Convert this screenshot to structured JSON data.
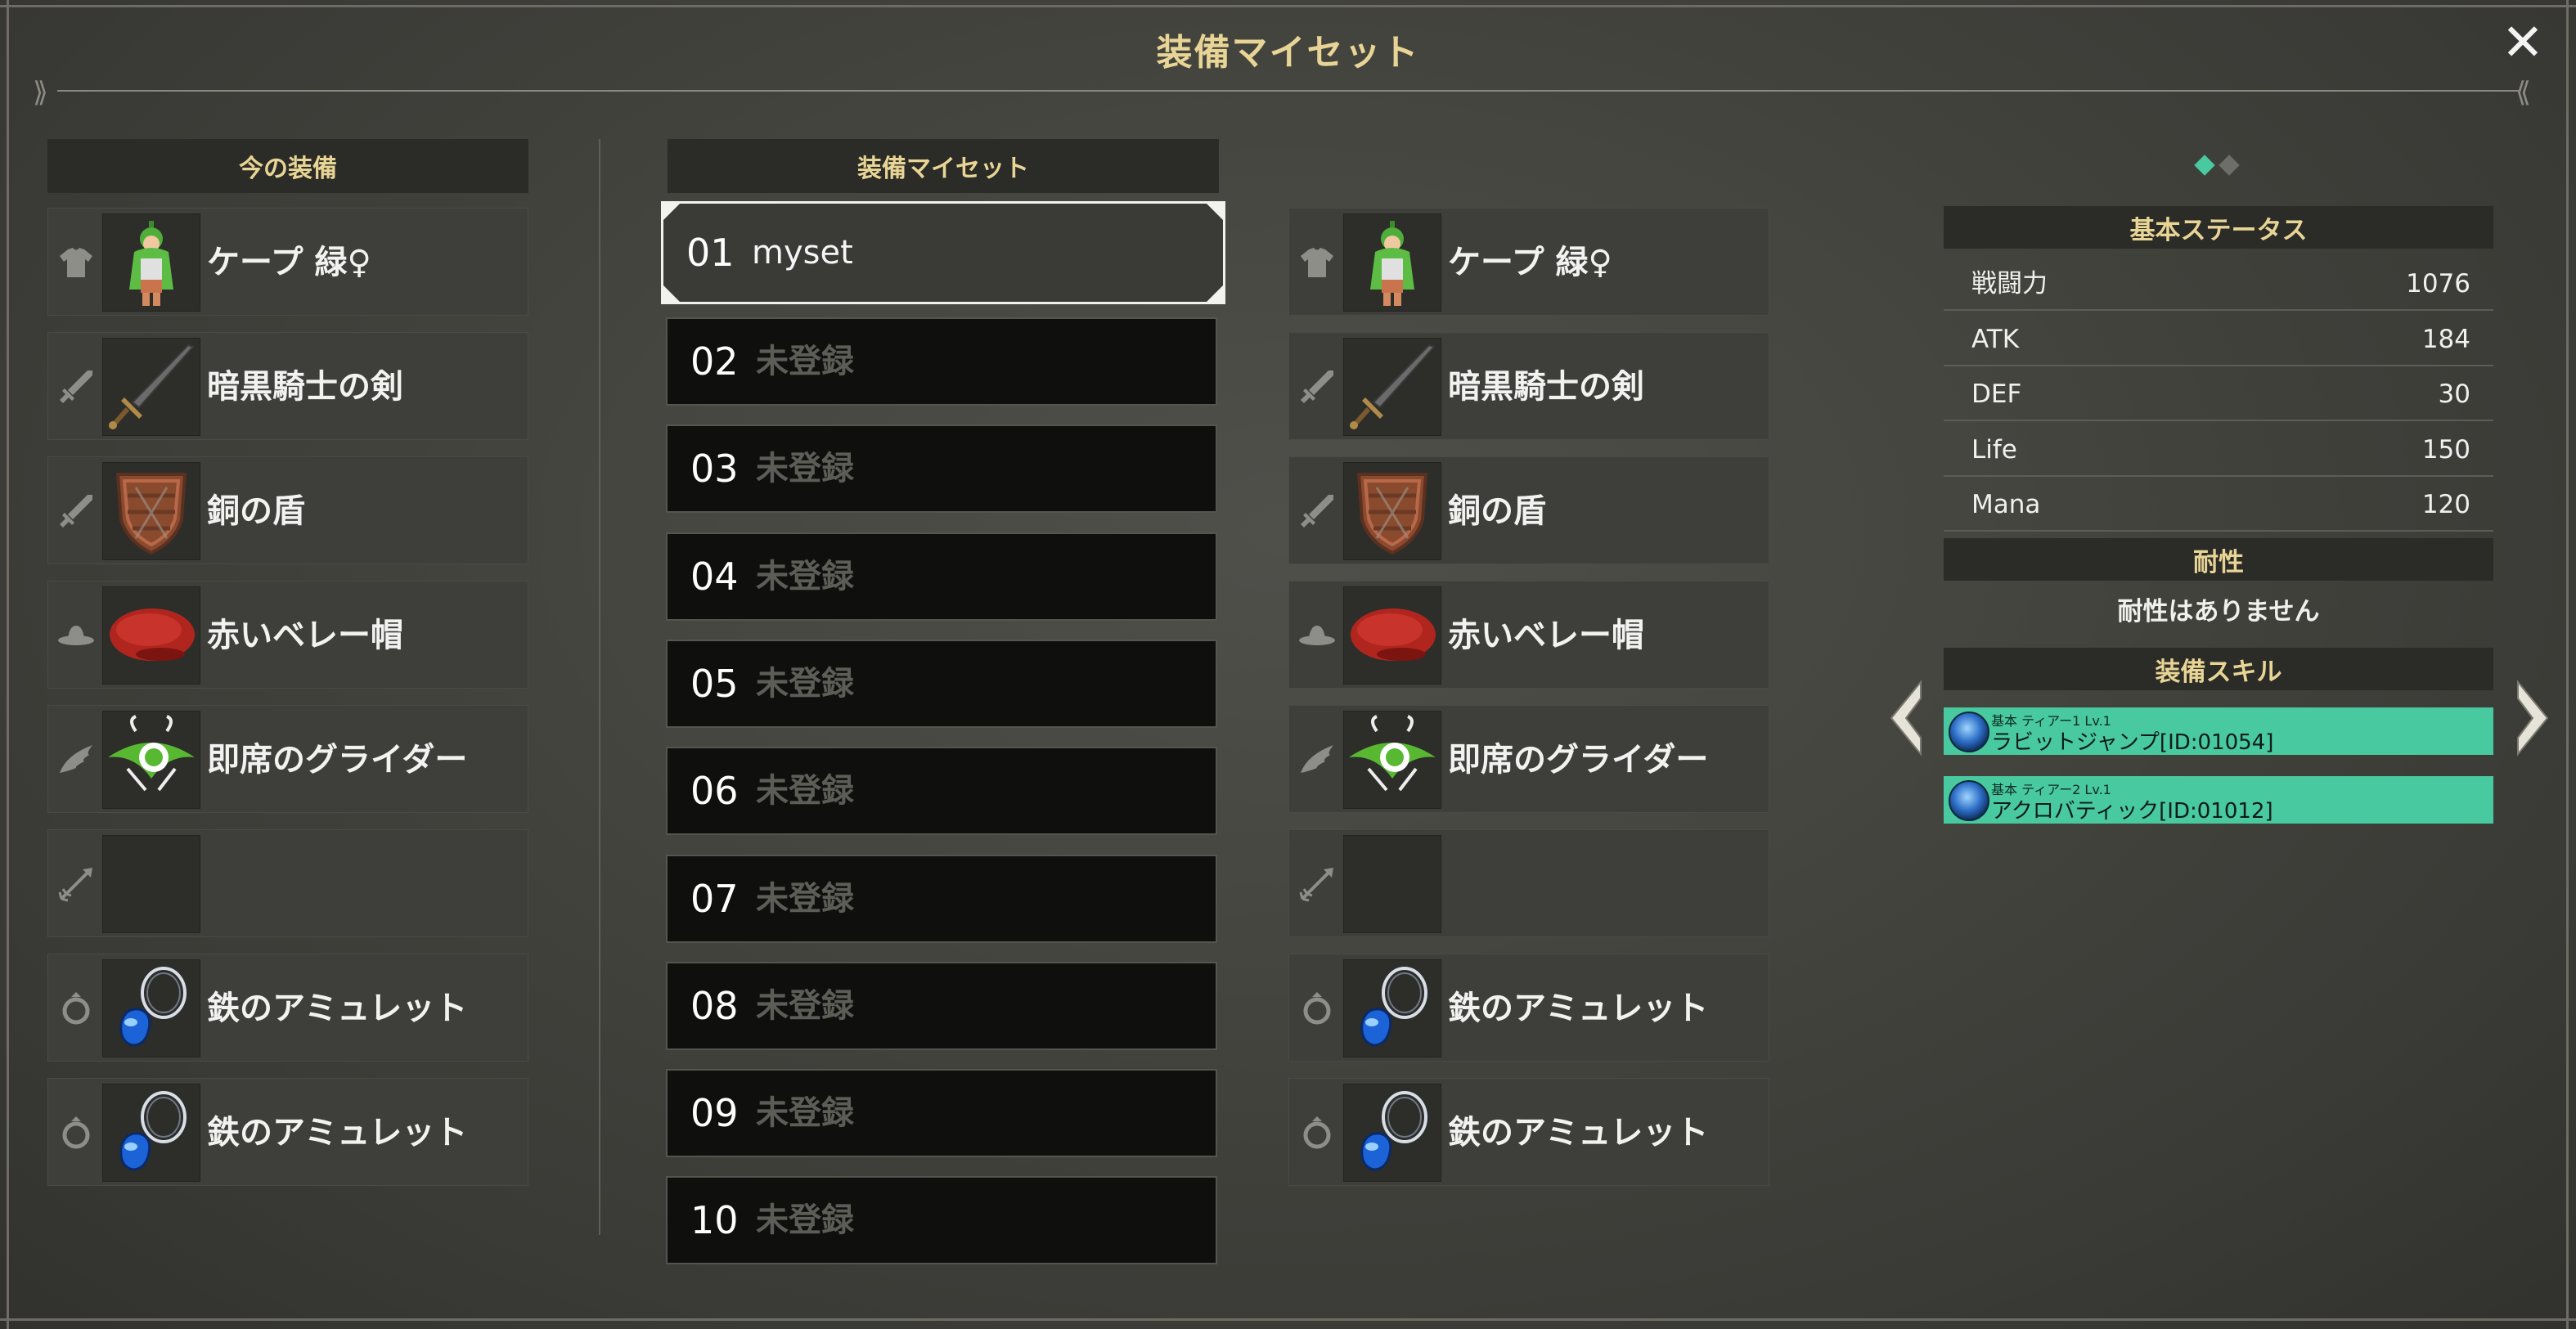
{
  "dialog": {
    "title": "装備マイセット",
    "close_icon": "close-icon"
  },
  "current_equipment": {
    "header": "今の装備",
    "items": [
      {
        "slot_icon": "shirt-icon",
        "item_icon": "cape-icon",
        "name": "ケープ 緑♀"
      },
      {
        "slot_icon": "sword-icon",
        "item_icon": "dark-sword-icon",
        "name": "暗黒騎士の剣"
      },
      {
        "slot_icon": "sword-icon",
        "item_icon": "shield-icon",
        "name": "銅の盾"
      },
      {
        "slot_icon": "hat-icon",
        "item_icon": "beret-icon",
        "name": "赤いベレー帽"
      },
      {
        "slot_icon": "wing-icon",
        "item_icon": "glider-icon",
        "name": "即席のグライダー"
      },
      {
        "slot_icon": "arrow-icon",
        "item_icon": "",
        "name": ""
      },
      {
        "slot_icon": "ring-icon",
        "item_icon": "amulet-icon",
        "name": "鉄のアミュレット"
      },
      {
        "slot_icon": "ring-icon",
        "item_icon": "amulet-icon",
        "name": "鉄のアミュレット"
      }
    ]
  },
  "myset_list": {
    "header": "装備マイセット",
    "selected_index": 0,
    "sets": [
      {
        "num": "01",
        "name": "myset"
      },
      {
        "num": "02",
        "name": "未登録"
      },
      {
        "num": "03",
        "name": "未登録"
      },
      {
        "num": "04",
        "name": "未登録"
      },
      {
        "num": "05",
        "name": "未登録"
      },
      {
        "num": "06",
        "name": "未登録"
      },
      {
        "num": "07",
        "name": "未登録"
      },
      {
        "num": "08",
        "name": "未登録"
      },
      {
        "num": "09",
        "name": "未登録"
      },
      {
        "num": "10",
        "name": "未登録"
      }
    ]
  },
  "set_preview": {
    "items": [
      {
        "slot_icon": "shirt-icon",
        "item_icon": "cape-icon",
        "name": "ケープ 緑♀"
      },
      {
        "slot_icon": "sword-icon",
        "item_icon": "dark-sword-icon",
        "name": "暗黒騎士の剣"
      },
      {
        "slot_icon": "sword-icon",
        "item_icon": "shield-icon",
        "name": "銅の盾"
      },
      {
        "slot_icon": "hat-icon",
        "item_icon": "beret-icon",
        "name": "赤いベレー帽"
      },
      {
        "slot_icon": "wing-icon",
        "item_icon": "glider-icon",
        "name": "即席のグライダー"
      },
      {
        "slot_icon": "arrow-icon",
        "item_icon": "",
        "name": ""
      },
      {
        "slot_icon": "ring-icon",
        "item_icon": "amulet-icon",
        "name": "鉄のアミュレット"
      },
      {
        "slot_icon": "ring-icon",
        "item_icon": "amulet-icon",
        "name": "鉄のアミュレット"
      }
    ]
  },
  "status_panel": {
    "page_indicator": {
      "pages": 2,
      "current": 0
    },
    "basic_status_header": "基本ステータス",
    "stats": [
      {
        "label": "戦闘力",
        "value": "1076"
      },
      {
        "label": "ATK",
        "value": "184"
      },
      {
        "label": "DEF",
        "value": "30"
      },
      {
        "label": "Life",
        "value": "150"
      },
      {
        "label": "Mana",
        "value": "120"
      }
    ],
    "resistance_header": "耐性",
    "resistance_text": "耐性はありません",
    "skills_header": "装備スキル",
    "skills": [
      {
        "tier": "基本 ティアー1 Lv.1",
        "name": "ラビットジャンプ[ID:01054]",
        "icon": "rabbit-jump-skill-icon"
      },
      {
        "tier": "基本 ティアー2 Lv.1",
        "name": "アクロバティック[ID:01012]",
        "icon": "acrobatic-skill-icon"
      }
    ],
    "prev_icon": "chevron-left-icon",
    "next_icon": "chevron-right-icon"
  },
  "colors": {
    "title_gold": "#e8d596",
    "skill_green": "#48c9a0",
    "page_dot_active": "#48c9a0",
    "page_dot_inactive": "#6e6e69"
  }
}
